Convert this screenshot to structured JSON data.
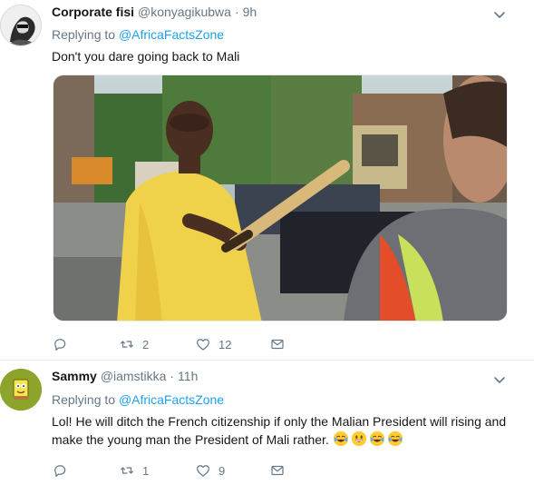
{
  "tweets": [
    {
      "name": "Corporate fisi",
      "handle": "@konyagikubwa",
      "separator": "·",
      "time": "9h",
      "replying_prefix": "Replying to",
      "replying_to": "@AfricaFactsZone",
      "text": "Don't you dare going back to Mali",
      "retweets": "2",
      "likes": "12"
    },
    {
      "name": "Sammy",
      "handle": "@iamstikka",
      "separator": "·",
      "time": "11h",
      "replying_prefix": "Replying to",
      "replying_to": "@AfricaFactsZone",
      "text": "Lol! He will ditch the French citizenship if only the Malian President will rising and make the young man the President of Mali rather.",
      "retweets": "1",
      "likes": "9"
    }
  ],
  "icons": {
    "reply": "reply-icon",
    "retweet": "retweet-icon",
    "like": "heart-icon",
    "message": "envelope-icon",
    "more": "chevron-down-icon",
    "emoji": [
      "tears-of-joy-emoji",
      "grinning-emoji",
      "tears-of-joy-emoji",
      "tears-of-joy-emoji"
    ]
  },
  "colors": {
    "link": "#1da1f2",
    "secondary_text": "#657786",
    "divider": "#e6ecf0"
  }
}
